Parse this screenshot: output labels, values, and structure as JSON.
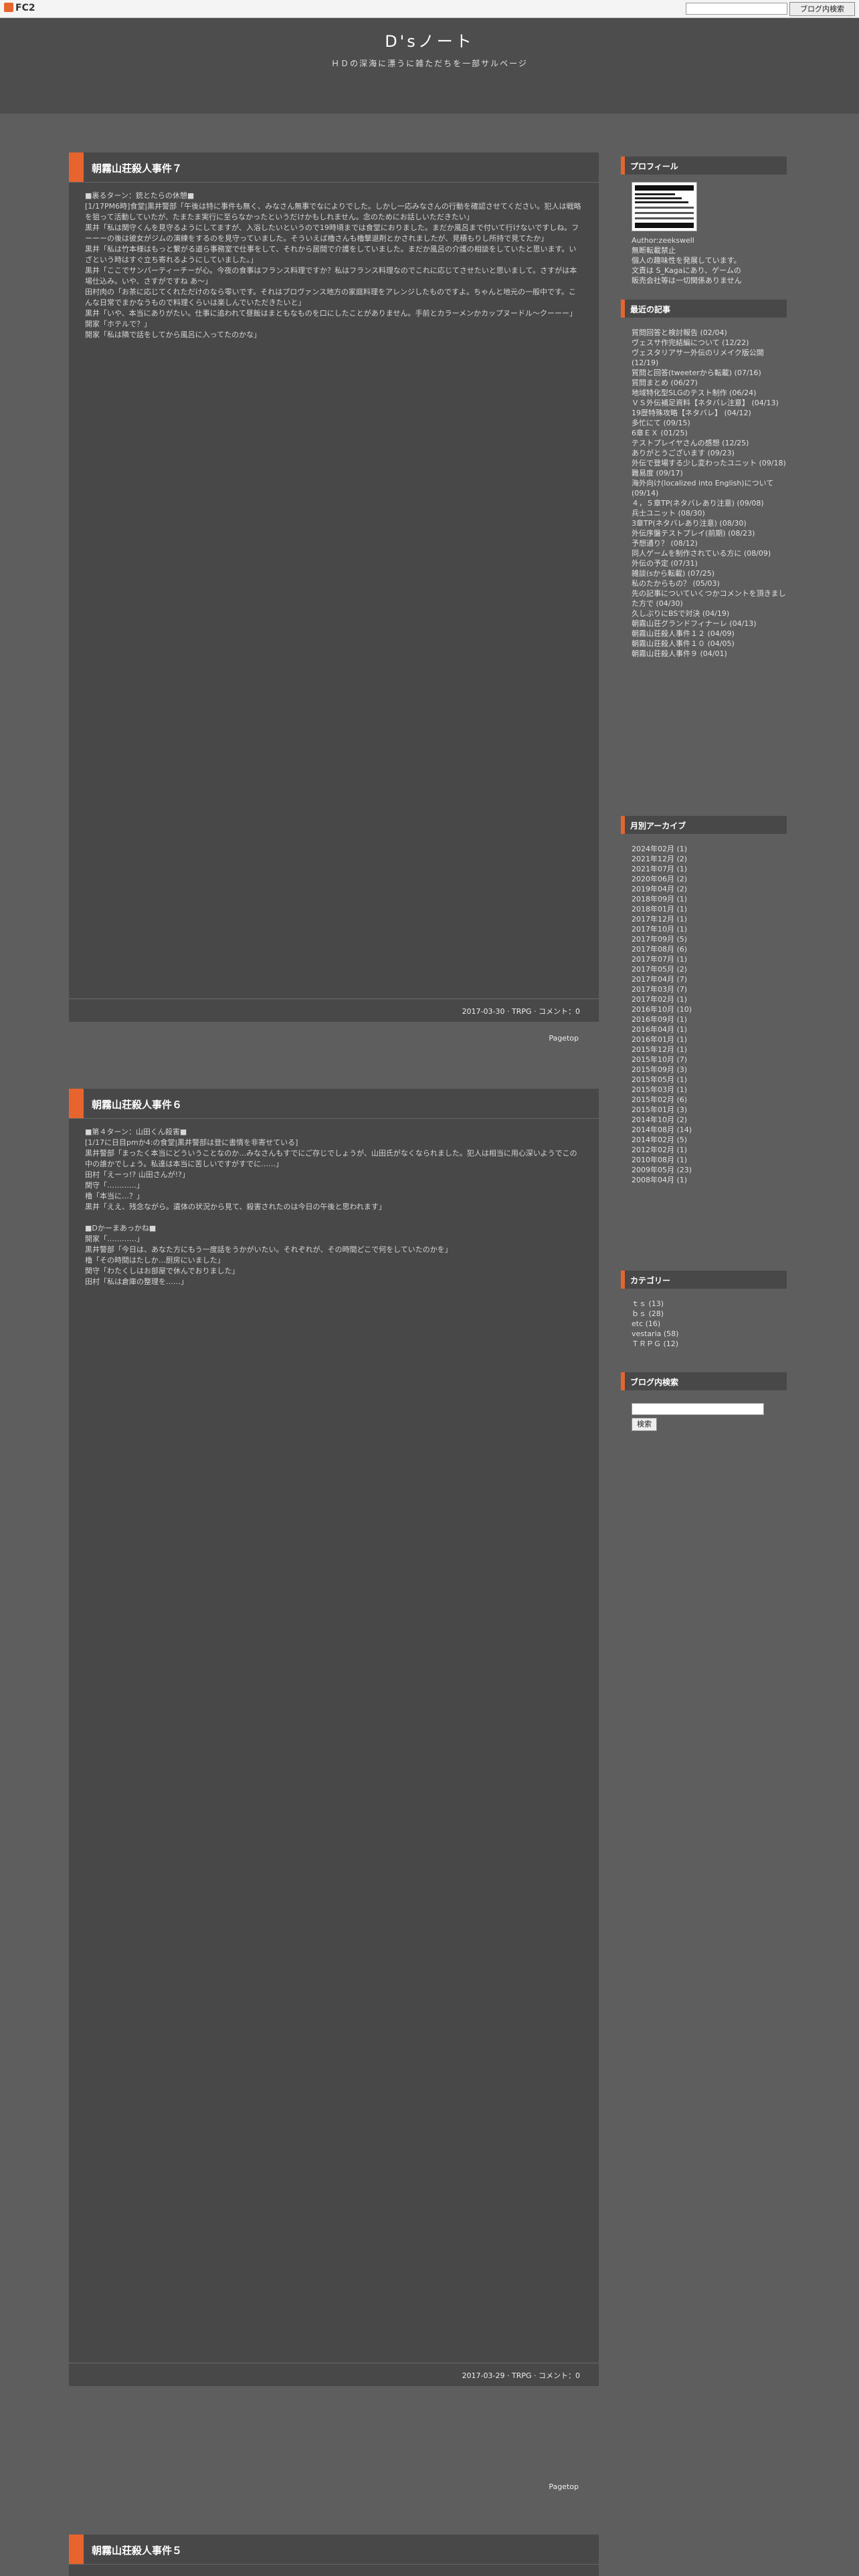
{
  "topbar": {
    "logo": "FC2",
    "search_button": "ブログ内検索"
  },
  "site": {
    "title": "D'sノート",
    "description": "ＨＤの深海に漂うに雑ただちを一部サルベージ"
  },
  "entries": [
    {
      "title": "朝霧山荘殺人事件７",
      "body": "■裏るターン：銃とたらの休憩■\n[1/17PM6時]食堂|黒井警部「午後は特に事件も無く、みなさん無事でなによりでした。しかし一応みなさんの行動を確認させてください。犯人は戦略を狙って活動していたが、たまたま実行に至らなかったというだけかもしれません。念のためにお話しいただきたい」\n黒井「私は関守くんを見守るようにしてますが、入浴したいというので19時頃までは食堂におりました。まだか風呂まで付いて行けないですしね。フーーーの後は彼女がジムの演練をするのを見守っていました。そういえば櫓さんも櫓撃退剤とかされましたが、見積もりし所持で見てたか」\n黒井「私は竹本様はもっと繋がる道ら事務室で仕事をして、それから居間で介護をしていました。まだか風呂の介護の相談をしていたと思います。いざという時はすぐ立ち寄れるようにしていました。」\n黒井「ここでサンバーティーチーが心。今夜の食事はフランス料理ですか？私はフランス料理なのでこれに応じてさせたいと思いまして。さすがは本場仕込み。いや、さすがですね あ〜」\n田村肉の「お茶に応じてくれただけのなら零いです。それはプロヴァンス地方の家庭料理をアレンジしたものですよ。ちゃんと地元の一般中です。こんな日常でまかなうもので料理くらいは楽しんでいただきたいと」\n黒井「いや、本当にありがたい。仕事に追われて昼飯はまともなものを口にしたことがありません。手前とカラーメンかカップヌードル〜クーーー」\n開家「ホテルで？」\n開家「私は隣で話をしてから風呂に入ってたのかな」",
      "footer": "2017-03-30 · TRPG · コメント：0"
    },
    {
      "title": "朝霧山荘殺人事件６",
      "body": "■第４ターン：山田くん殺害■\n[1/17に日目pmか4:の食堂|黒井警部は登に書情を非寄せている]\n黒井警部「まったく本当にどういうことなのか…みなさんもすでにご存じでしょうが、山田氏がなくなられました。犯人は相当に用心深いようでこの中の誰かでしょう。私達は本当に苦しいですがすでに……」\n田村「えーっ!? 山田さんが!?」\n関守「…………」\n櫓「本当に…？」\n黒井「ええ、残念ながら。遺体の状況から見て、殺害されたのは今日の午後と思われます」\n\n■Dかーまあっかね■\n開家「…………」\n黒井警部「今日は、あなた方にもう一度話をうかがいたい。それぞれが、その時間どこで何をしていたのかを」\n櫓「その時間はたしか…厨房にいました」\n関守「わたくしはお部屋で休んでおりました」\n田村「私は倉庫の整理を……」",
      "footer": "2017-03-29 · TRPG · コメント：0"
    },
    {
      "title": "朝霧山荘殺人事件５"
    }
  ],
  "pagetop": "Pagetop",
  "sidebar": {
    "profile": {
      "heading": "プロフィール",
      "author": "Author:zeekswell",
      "lines": [
        "無断転載禁止",
        "個人の趣味性を発展しています。",
        "文責は S_Kagaにあり、ゲームの",
        "販売会社等は一切関係ありません"
      ]
    },
    "recent": {
      "heading": "最近の記事",
      "items": [
        "質問回答と検討報告 (02/04)",
        "ヴェスサ作完結編について (12/22)",
        "ヴェスタリアサー外伝のリメイク版公開 (12/19)",
        "質問と回答(tweeterから転載) (07/16)",
        "質問まとめ (06/27)",
        "地域特化型SLGのテスト制作 (06/24)",
        "ＶＳ外伝補足資料【ネタバレ注意】 (04/13)",
        "19歴特殊攻略【ネタバレ】 (04/12)",
        "多忙にて (09/15)",
        "6章ＥＸ (01/25)",
        "テストプレイヤさんの感想 (12/25)",
        "ありがとうございます (09/23)",
        "外伝で登場する少し変わったユニット (09/18)",
        "難易度 (09/17)",
        "海外向け(localized into English)について (09/14)",
        "４，５章TP(ネタバレあり注意) (09/08)",
        "兵士ユニット (08/30)",
        "3章TP(ネタバレあり注意) (08/30)",
        "外伝序盤テストプレイ(前期) (08/23)",
        "予想通り？ (08/12)",
        "同人ゲームを制作されている方に (08/09)",
        "外伝の予定 (07/31)",
        "雑談(sから転載) (07/25)",
        "私のたからもの？ (05/03)",
        "先の記事についていくつかコメントを頂きました方で (04/30)",
        "久しぶりにBSで対決 (04/19)",
        "朝霧山荘グランドフィナーレ (04/13)",
        "朝霧山荘殺人事件１２ (04/09)",
        "朝霧山荘殺人事件１０ (04/05)",
        "朝霧山荘殺人事件９ (04/01)"
      ]
    },
    "archive": {
      "heading": "月別アーカイブ",
      "items": [
        "2024年02月 (1)",
        "2021年12月 (2)",
        "2021年07月 (1)",
        "2020年06月 (2)",
        "2019年04月 (2)",
        "2018年09月 (1)",
        "2018年01月 (1)",
        "2017年12月 (1)",
        "2017年10月 (1)",
        "2017年09月 (5)",
        "2017年08月 (6)",
        "2017年07月 (1)",
        "2017年05月 (2)",
        "2017年04月 (7)",
        "2017年03月 (7)",
        "2017年02月 (1)",
        "2016年10月 (10)",
        "2016年09月 (1)",
        "2016年04月 (1)",
        "2016年01月 (1)",
        "2015年12月 (1)",
        "2015年10月 (7)",
        "2015年09月 (3)",
        "2015年05月 (1)",
        "2015年03月 (1)",
        "2015年02月 (6)",
        "2015年01月 (3)",
        "2014年10月 (2)",
        "2014年08月 (14)",
        "2014年02月 (5)",
        "2012年02月 (1)",
        "2010年08月 (1)",
        "2009年05月 (23)",
        "2008年04月 (1)"
      ]
    },
    "categories": {
      "heading": "カテゴリー",
      "items": [
        "ｔｓ (13)",
        "ｂｓ (28)",
        "etc (16)",
        "vestaria (58)",
        "ＴＲＰＧ (12)"
      ]
    },
    "search": {
      "heading": "ブログ内検索",
      "button": "検索"
    }
  }
}
